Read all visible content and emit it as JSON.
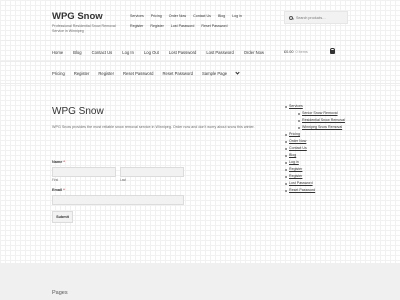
{
  "site": {
    "title": "WPG Snow",
    "description": "Professional Residential Snow Removal Service in Winnipeg"
  },
  "top_nav": {
    "row1": [
      "Services",
      "Pricing",
      "Order Now",
      "Contact Us",
      "Blog",
      "Log in"
    ],
    "row2": [
      "Register",
      "Register",
      "Lost Password",
      "Reset Password"
    ]
  },
  "search": {
    "placeholder": "Search products…"
  },
  "primary_nav": [
    "Home",
    "Blog",
    "Contact Us",
    "Log In",
    "Log Out",
    "Lost Password",
    "Lost Password",
    "Order Now"
  ],
  "cart": {
    "amount": "£0.00",
    "count": "0 items"
  },
  "secondary_nav": [
    "Pricing",
    "Register",
    "Register",
    "Reset Password",
    "Reset Password",
    "Sample Page"
  ],
  "page": {
    "title": "WPG Snow",
    "intro": "WPG Snow provides the most reliable snow removal service in Winnipeg. Order now and don't worry about snow this winter."
  },
  "form": {
    "name_label": "Name",
    "required_mark": "*",
    "first_sub": "First",
    "last_sub": "Last",
    "email_label": "Email",
    "submit_label": "Submit"
  },
  "sidebar": {
    "items": [
      {
        "label": "Services",
        "level": 0
      },
      {
        "label": "Senior Snow Removal",
        "level": 1
      },
      {
        "label": "Residential Snow Removal",
        "level": 1
      },
      {
        "label": "Winnipeg Snow Removal",
        "level": 1
      },
      {
        "label": "Pricing",
        "level": 0
      },
      {
        "label": "Order Now",
        "level": 0
      },
      {
        "label": "Contact Us",
        "level": 0
      },
      {
        "label": "Blog",
        "level": 0
      },
      {
        "label": "Log in",
        "level": 0
      },
      {
        "label": "Register",
        "level": 0
      },
      {
        "label": "Register",
        "level": 0
      },
      {
        "label": "Lost Password",
        "level": 0
      },
      {
        "label": "Reset Password",
        "level": 0
      }
    ]
  },
  "footer": {
    "title": "Pages"
  },
  "colors": {
    "accent_required": "#b22222",
    "footer_bg": "#f0f0f0",
    "text": "#333333"
  }
}
